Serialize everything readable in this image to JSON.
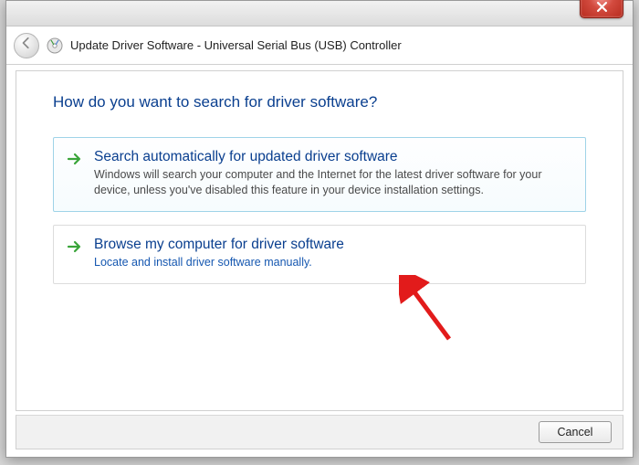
{
  "window": {
    "title": "Update Driver Software - Universal Serial Bus (USB) Controller"
  },
  "question": "How do you want to search for driver software?",
  "options": [
    {
      "title": "Search automatically for updated driver software",
      "desc": "Windows will search your computer and the Internet for the latest driver software for your device, unless you've disabled this feature in your device installation settings."
    },
    {
      "title": "Browse my computer for driver software",
      "desc": "Locate and install driver software manually."
    }
  ],
  "buttons": {
    "cancel": "Cancel"
  }
}
